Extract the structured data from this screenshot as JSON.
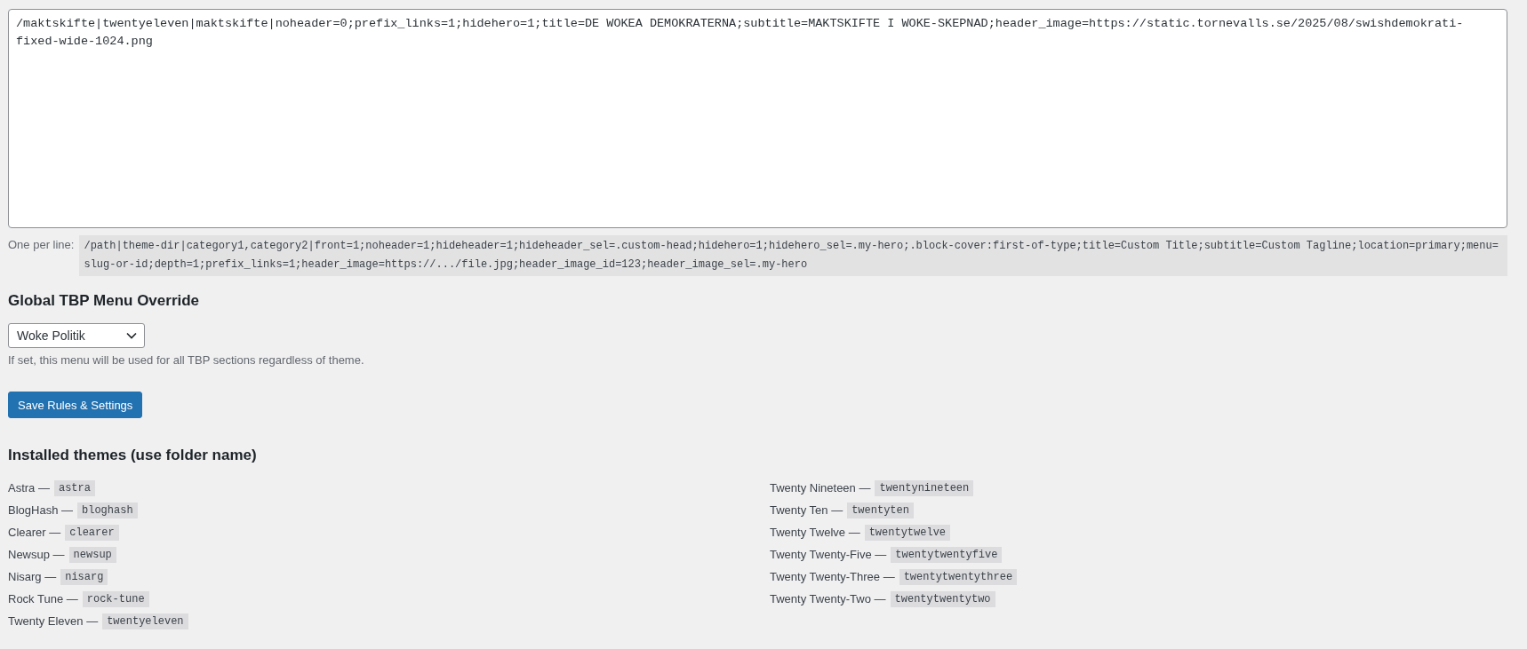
{
  "rules": {
    "value": "/maktskifte|twentyeleven|maktskifte|noheader=0;prefix_links=1;hidehero=1;title=DE WOKEA DEMOKRATERNA;subtitle=MAKTSKIFTE I WOKE-SKEPNAD;header_image=https://static.tornevalls.se/2025/08/swishdemokrati-fixed-wide-1024.png"
  },
  "help": {
    "label": "One per line:",
    "example": "/path|theme-dir|category1,category2|front=1;noheader=1;hideheader=1;hideheader_sel=.custom-head;hidehero=1;hidehero_sel=.my-hero;.block-cover:first-of-type;title=Custom Title;subtitle=Custom Tagline;location=primary;menu=slug-or-id;depth=1;prefix_links=1;header_image=https://.../file.jpg;header_image_id=123;header_image_sel=.my-hero"
  },
  "menu_override": {
    "heading": "Global TBP Menu Override",
    "value": "Woke Politik",
    "description": "If set, this menu will be used for all TBP sections regardless of theme."
  },
  "save_button": "Save Rules & Settings",
  "themes": {
    "heading": "Installed themes (use folder name)",
    "items": [
      {
        "name": "Astra —",
        "folder": "astra"
      },
      {
        "name": "BlogHash —",
        "folder": "bloghash"
      },
      {
        "name": "Clearer —",
        "folder": "clearer"
      },
      {
        "name": "Newsup —",
        "folder": "newsup"
      },
      {
        "name": "Nisarg —",
        "folder": "nisarg"
      },
      {
        "name": "Rock Tune —",
        "folder": "rock-tune"
      },
      {
        "name": "Twenty Eleven —",
        "folder": "twentyeleven"
      },
      {
        "name": "Twenty Nineteen —",
        "folder": "twentynineteen"
      },
      {
        "name": "Twenty Ten —",
        "folder": "twentyten"
      },
      {
        "name": "Twenty Twelve —",
        "folder": "twentytwelve"
      },
      {
        "name": "Twenty Twenty-Five —",
        "folder": "twentytwentyfive"
      },
      {
        "name": "Twenty Twenty-Three —",
        "folder": "twentytwentythree"
      },
      {
        "name": "Twenty Twenty-Two —",
        "folder": "twentytwentytwo"
      }
    ]
  }
}
